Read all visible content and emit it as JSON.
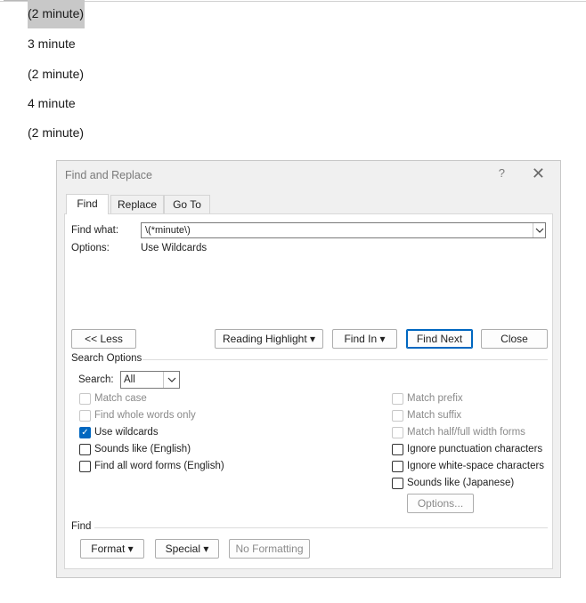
{
  "document": {
    "lines": [
      "(2 minute)",
      "3 minute",
      "(2 minute)",
      "4 minute",
      "(2 minute)"
    ]
  },
  "dialog": {
    "title": "Find and Replace",
    "help_glyph": "?",
    "close_glyph": "✕",
    "tabs": [
      "Find",
      "Replace",
      "Go To"
    ],
    "find_what_label": "Find what:",
    "find_what_value": "\\(*minute\\)",
    "options_label": "Options:",
    "options_value": "Use Wildcards",
    "buttons": {
      "less": "<< Less",
      "reading_highlight": "Reading Highlight",
      "find_in": "Find In",
      "find_next": "Find Next",
      "close": "Close",
      "options": "Options...",
      "format": "Format",
      "special": "Special",
      "no_formatting": "No Formatting"
    },
    "search_options_title": "Search Options",
    "search_label": "Search:",
    "search_value": "All",
    "left_checks": [
      {
        "label": "Match case",
        "checked": false,
        "disabled": true
      },
      {
        "label": "Find whole words only",
        "checked": false,
        "disabled": true
      },
      {
        "label": "Use wildcards",
        "checked": true,
        "disabled": false
      },
      {
        "label": "Sounds like (English)",
        "checked": false,
        "disabled": false
      },
      {
        "label": "Find all word forms (English)",
        "checked": false,
        "disabled": false
      }
    ],
    "right_checks": [
      {
        "label": "Match prefix",
        "checked": false,
        "disabled": true
      },
      {
        "label": "Match suffix",
        "checked": false,
        "disabled": true
      },
      {
        "label": "Match half/full width forms",
        "checked": false,
        "disabled": true
      },
      {
        "label": "Ignore punctuation characters",
        "checked": false,
        "disabled": false
      },
      {
        "label": "Ignore white-space characters",
        "checked": false,
        "disabled": false
      },
      {
        "label": "Sounds like (Japanese)",
        "checked": false,
        "disabled": false
      }
    ],
    "find_section_title": "Find",
    "icons": {
      "dropdown_caret": "chevron-down-icon",
      "checkmark": "check-icon"
    },
    "colors": {
      "accent": "#0067c0",
      "selection": "#c8c8c8"
    }
  }
}
